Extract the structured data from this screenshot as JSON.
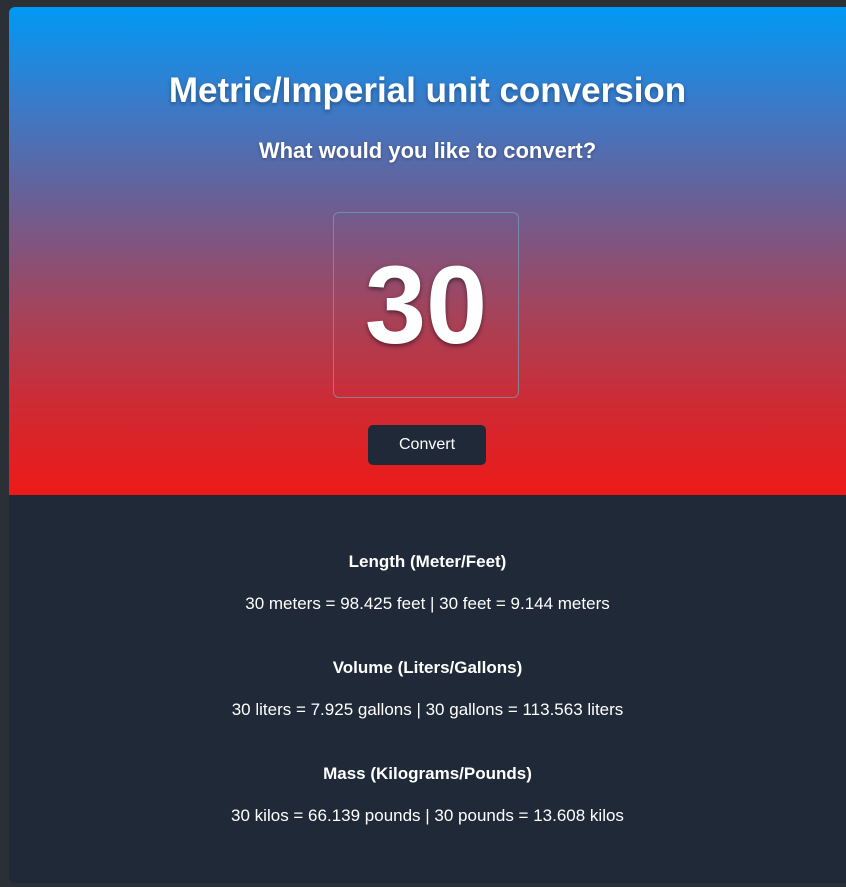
{
  "header": {
    "title": "Metric/Imperial unit conversion",
    "subtitle": "What would you like to convert?"
  },
  "input": {
    "value": "30"
  },
  "convert_label": "Convert",
  "colors": {
    "gradient_top": "#0099f5",
    "gradient_bottom": "#ee1a18",
    "panel": "#1f2937"
  },
  "results": [
    {
      "title": "Length (Meter/Feet)",
      "text": "30 meters = 98.425 feet | 30 feet = 9.144 meters"
    },
    {
      "title": "Volume (Liters/Gallons)",
      "text": "30 liters = 7.925 gallons | 30 gallons = 113.563 liters"
    },
    {
      "title": "Mass (Kilograms/Pounds)",
      "text": "30 kilos = 66.139 pounds | 30 pounds = 13.608 kilos"
    }
  ]
}
